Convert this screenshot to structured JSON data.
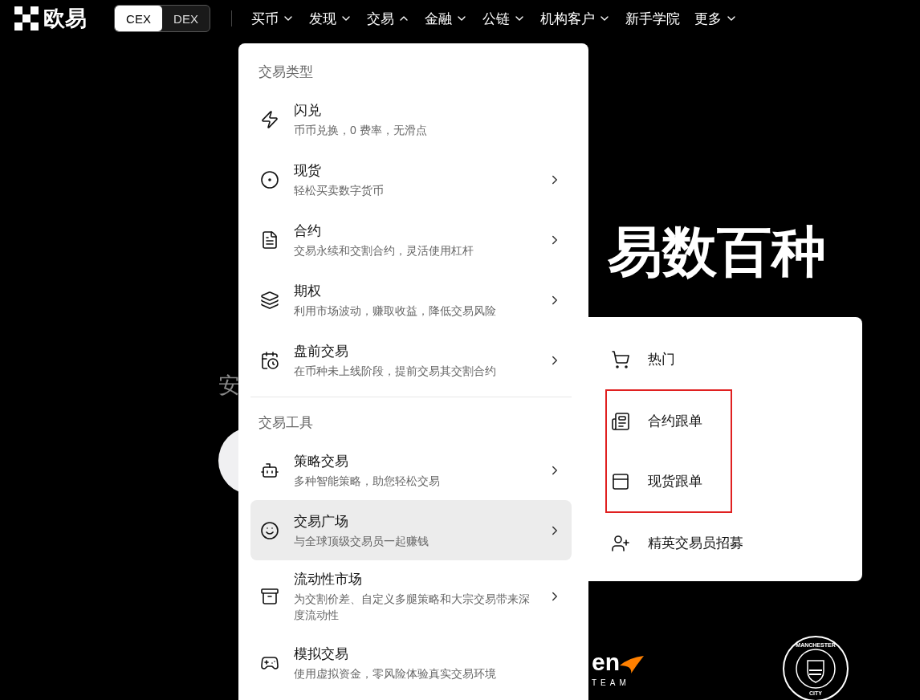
{
  "nav": {
    "logo": "欧易",
    "modes": [
      {
        "label": "CEX",
        "selected": true
      },
      {
        "label": "DEX",
        "selected": false
      }
    ],
    "items": [
      {
        "label": "买币",
        "dropdown": true,
        "expanded": false
      },
      {
        "label": "发现",
        "dropdown": true,
        "expanded": false
      },
      {
        "label": "交易",
        "dropdown": true,
        "expanded": true
      },
      {
        "label": "金融",
        "dropdown": true,
        "expanded": false
      },
      {
        "label": "公链",
        "dropdown": true,
        "expanded": false
      },
      {
        "label": "机构客户",
        "dropdown": true,
        "expanded": false
      },
      {
        "label": "新手学院",
        "dropdown": false
      },
      {
        "label": "更多",
        "dropdown": true,
        "expanded": false
      }
    ]
  },
  "hero": {
    "heading": "易数百种",
    "subtitle": "安",
    "partners": {
      "racing_logo": "en",
      "racing_team": "TEAM",
      "badge_top": "MANCHESTER",
      "badge_bottom": "CITY"
    }
  },
  "trade_menu": {
    "sections": [
      {
        "title": "交易类型",
        "items": [
          {
            "title": "闪兑",
            "desc": "币币兑换，0 费率，无滑点",
            "has_submenu": false,
            "selected": false
          },
          {
            "title": "现货",
            "desc": "轻松买卖数字货币",
            "has_submenu": true,
            "selected": false
          },
          {
            "title": "合约",
            "desc": "交易永续和交割合约，灵活使用杠杆",
            "has_submenu": true,
            "selected": false
          },
          {
            "title": "期权",
            "desc": "利用市场波动，赚取收益，降低交易风险",
            "has_submenu": true,
            "selected": false
          },
          {
            "title": "盘前交易",
            "desc": "在币种未上线阶段，提前交易其交割合约",
            "has_submenu": true,
            "selected": false
          }
        ]
      },
      {
        "title": "交易工具",
        "items": [
          {
            "title": "策略交易",
            "desc": "多种智能策略，助您轻松交易",
            "has_submenu": true,
            "selected": false
          },
          {
            "title": "交易广场",
            "desc": "与全球顶级交易员一起赚钱",
            "has_submenu": true,
            "selected": true
          },
          {
            "title": "流动性市场",
            "desc": "为交割价差、自定义多腿策略和大宗交易带来深度流动性",
            "has_submenu": true,
            "selected": false
          },
          {
            "title": "模拟交易",
            "desc": "使用虚拟资金，零风险体验真实交易环境",
            "has_submenu": false,
            "selected": false
          }
        ]
      }
    ]
  },
  "sub_menu": {
    "items": [
      {
        "label": "热门",
        "highlighted": false
      },
      {
        "label": "合约跟单",
        "highlighted": true
      },
      {
        "label": "现货跟单",
        "highlighted": true
      },
      {
        "label": "精英交易员招募",
        "highlighted": false
      }
    ]
  }
}
